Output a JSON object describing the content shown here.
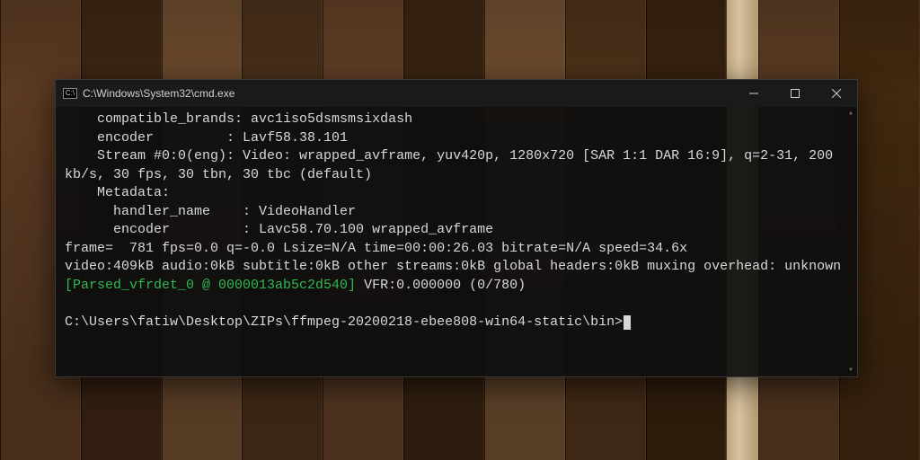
{
  "window": {
    "title": "C:\\Windows\\System32\\cmd.exe"
  },
  "lines": {
    "l0": "    compatible_brands: avc1iso5dsmsmsixdash",
    "l1": "    encoder         : Lavf58.38.101",
    "l2": "    Stream #0:0(eng): Video: wrapped_avframe, yuv420p, 1280x720 [SAR 1:1 DAR 16:9], q=2-31, 200 kb/s, 30 fps, 30 tbn, 30 tbc (default)",
    "l3": "    Metadata:",
    "l4": "      handler_name    : VideoHandler",
    "l5": "      encoder         : Lavc58.70.100 wrapped_avframe",
    "l6": "frame=  781 fps=0.0 q=-0.0 Lsize=N/A time=00:00:26.03 bitrate=N/A speed=34.6x",
    "l7": "video:409kB audio:0kB subtitle:0kB other streams:0kB global headers:0kB muxing overhead: unknown",
    "l8a": "[Parsed_vfrdet_0 @ 0000013ab5c2d540]",
    "l8b": " VFR:0.000000 (0/780)",
    "prompt": "C:\\Users\\fatiw\\Desktop\\ZIPs\\ffmpeg-20200218-ebee808-win64-static\\bin>"
  },
  "icons": {
    "cmd": "C:\\",
    "scroll_up": "▴",
    "scroll_down": "▾"
  }
}
